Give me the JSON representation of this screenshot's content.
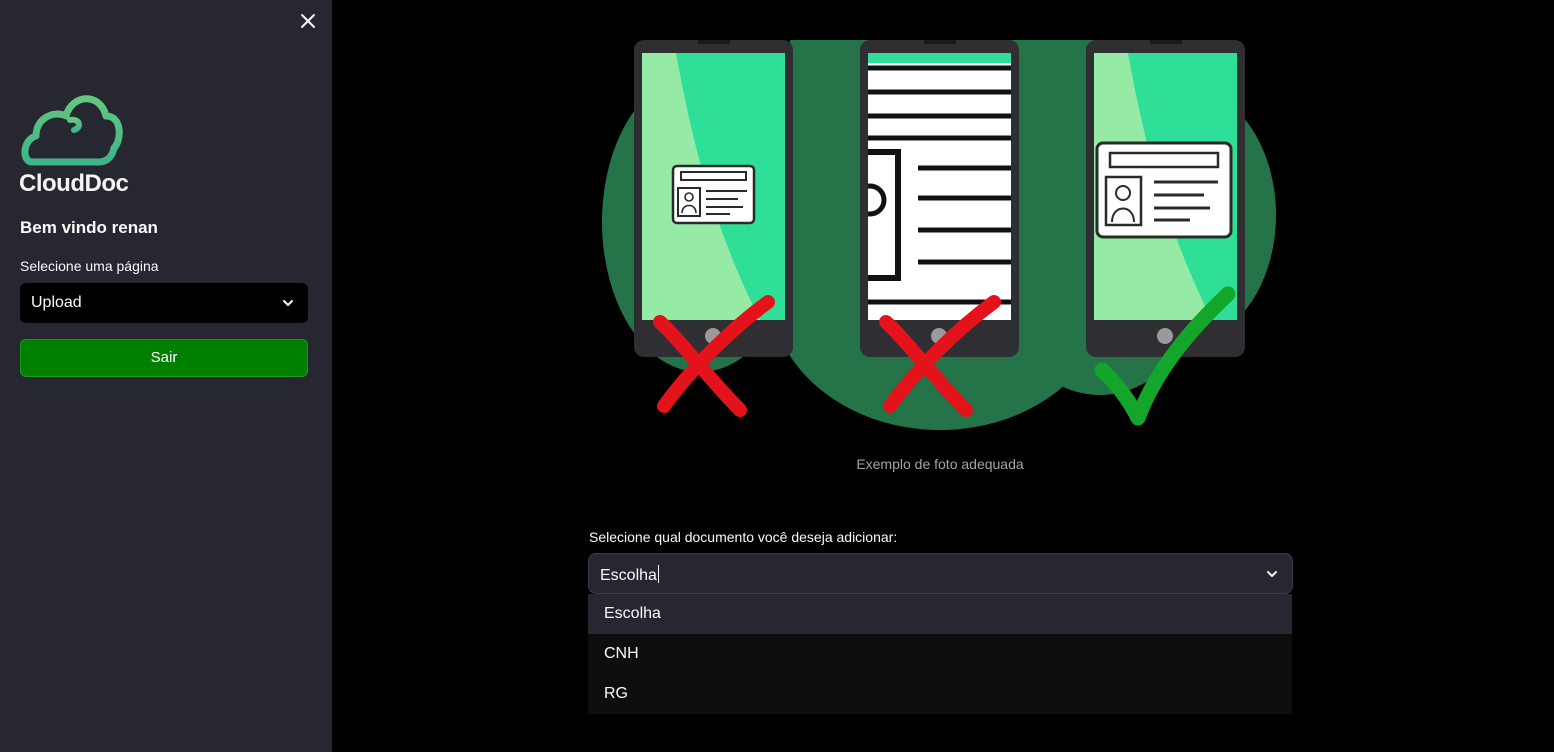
{
  "sidebar": {
    "logo_text": "CloudDoc",
    "welcome": "Bem vindo renan",
    "page_select_label": "Selecione uma página",
    "page_select_value": "Upload",
    "logout_label": "Sair"
  },
  "main": {
    "caption": "Exemplo de foto adequada",
    "doc_select_label": "Selecione qual documento você deseja adicionar:",
    "doc_select_value": "Escolha",
    "options": [
      "Escolha",
      "CNH",
      "RG"
    ]
  },
  "colors": {
    "sidebar_bg": "#262730",
    "main_bg": "#000000",
    "accent_green": "#008000",
    "logo_green": "#5fd08a",
    "illustration_dark_green": "#257349",
    "illustration_light_green": "#2fdf97",
    "cross_red": "#e3121b",
    "check_green": "#14a52b"
  },
  "icons": [
    "close-icon",
    "chevron-down-icon",
    "cloud-logo-icon",
    "id-card-icon",
    "cross-icon",
    "check-icon"
  ]
}
